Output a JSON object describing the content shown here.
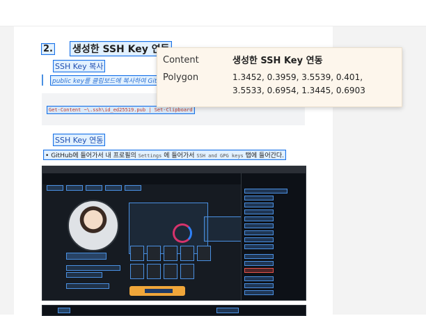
{
  "doc": {
    "heading_number": "2.",
    "heading_title": "생성한 SSH Key 연동",
    "sub1": "SSH Key 복사",
    "quote": "public key를 클립보드에 복사하여 GitHub",
    "code": "Get-Content ~\\.ssh\\id_ed25519.pub | Set-Clipboard",
    "sub2": "SSH Key 연동",
    "bullet_pre": "GitHub에 들어가서 내 프로필의 ",
    "bullet_code1": "Settings",
    "bullet_mid": " 에 들어가서 ",
    "bullet_code2": "SSH and GPG keys",
    "bullet_post": " 탭에 들어간다."
  },
  "tooltip": {
    "content_label": "Content",
    "content_value": "생성한 SSH Key 연동",
    "polygon_label": "Polygon",
    "polygon_value": "1.3452, 0.3959, 3.5539, 0.401, 3.5533, 0.6954, 1.3445, 0.6903"
  },
  "colors": {
    "highlight_border": "#1a73e8",
    "code_text": "#c0392b",
    "tooltip_bg": "#fdf6ec",
    "github_dark": "#0d1117"
  }
}
